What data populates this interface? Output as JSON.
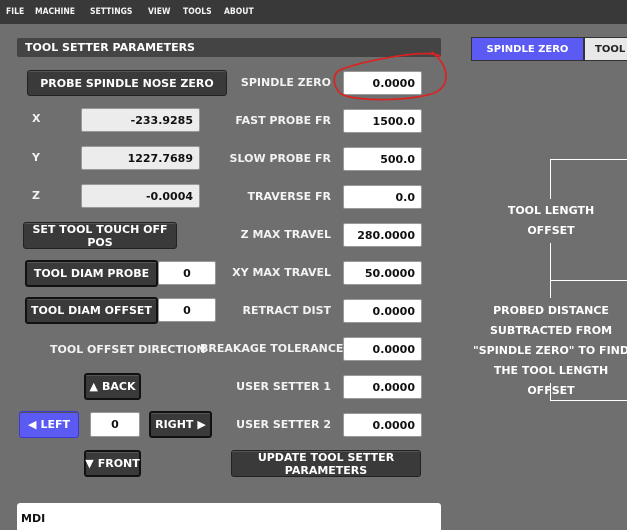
{
  "menu": [
    "FILE",
    "MACHINE",
    "SETTINGS",
    "VIEW",
    "TOOLS",
    "ABOUT"
  ],
  "section_title": "TOOL SETTER PARAMETERS",
  "left": {
    "probe_button": "PROBE SPINDLE NOSE ZERO",
    "axes": [
      {
        "label": "X",
        "value": "-233.9285"
      },
      {
        "label": "Y",
        "value": "1227.7689"
      },
      {
        "label": "Z",
        "value": "-0.0004"
      }
    ],
    "set_touch_off_button": "SET TOOL TOUCH OFF POS",
    "tool_diam_probe_button": "TOOL DIAM PROBE",
    "tool_diam_probe_value": "0",
    "tool_diam_offset_button": "TOOL DIAM OFFSET",
    "tool_diam_offset_value": "0",
    "offset_direction_label": "TOOL OFFSET DIRECTION",
    "back_button": "BACK",
    "left_button": "LEFT",
    "direction_value": "0",
    "right_button": "RIGHT",
    "front_button": "FRONT"
  },
  "params": [
    {
      "label": "SPINDLE ZERO",
      "value": "0.0000"
    },
    {
      "label": "FAST PROBE FR",
      "value": "1500.0"
    },
    {
      "label": "SLOW PROBE FR",
      "value": "500.0"
    },
    {
      "label": "TRAVERSE FR",
      "value": "0.0"
    },
    {
      "label": "Z MAX TRAVEL",
      "value": "280.0000"
    },
    {
      "label": "XY MAX TRAVEL",
      "value": "50.0000"
    },
    {
      "label": "RETRACT DIST",
      "value": "0.0000"
    },
    {
      "label": "BREAKAGE TOLERANCE",
      "value": "0.0000"
    },
    {
      "label": "USER SETTER 1",
      "value": "0.0000"
    },
    {
      "label": "USER SETTER 2",
      "value": "0.0000"
    }
  ],
  "update_button": "UPDATE TOOL SETTER PARAMETERS",
  "right_panel": {
    "tabs": [
      "SPINDLE ZERO",
      "TOOL T"
    ],
    "tool_length_offset": [
      "TOOL LENGTH",
      "OFFSET"
    ],
    "probed_distance": [
      "PROBED DISTANCE",
      "SUBTRACTED FROM",
      "\"SPINDLE ZERO\" TO FIND",
      "THE TOOL LENGTH OFFSET"
    ]
  },
  "mdi_label": "MDI",
  "colors": {
    "background": "#6f6f6f",
    "menubar": "#393939",
    "accent_blue": "#5b5bf3",
    "annotation_red": "#e0201c"
  }
}
